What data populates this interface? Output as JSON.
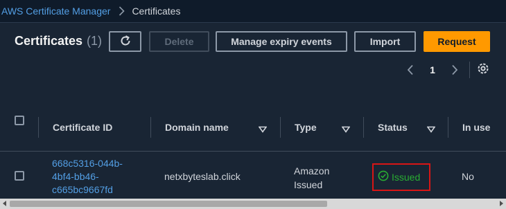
{
  "breadcrumb": {
    "service": "AWS Certificate Manager",
    "current": "Certificates"
  },
  "header": {
    "title": "Certificates",
    "count": "(1)"
  },
  "toolbar": {
    "delete_label": "Delete",
    "expiry_label": "Manage expiry events",
    "import_label": "Import",
    "request_label": "Request"
  },
  "pagination": {
    "page": "1"
  },
  "table": {
    "columns": [
      "Certificate ID",
      "Domain name",
      "Type",
      "Status",
      "In use"
    ],
    "rows": [
      {
        "cert_id_lines": [
          "668c5316-044b-",
          "4bf4-bb46-",
          "c665bc9667fd"
        ],
        "domain": "netxbyteslab.click",
        "type_lines": [
          "Amazon",
          "Issued"
        ],
        "status": "Issued",
        "in_use": "No"
      }
    ]
  },
  "icons": {
    "refresh": "refresh-icon",
    "settings": "gear-icon",
    "sort": "caret-down-icon",
    "status": "check-circle-icon"
  },
  "colors": {
    "accent_link": "#539fe5",
    "primary_button": "#ff9900",
    "status_success": "#29ad32",
    "highlight_border": "#d91515"
  }
}
